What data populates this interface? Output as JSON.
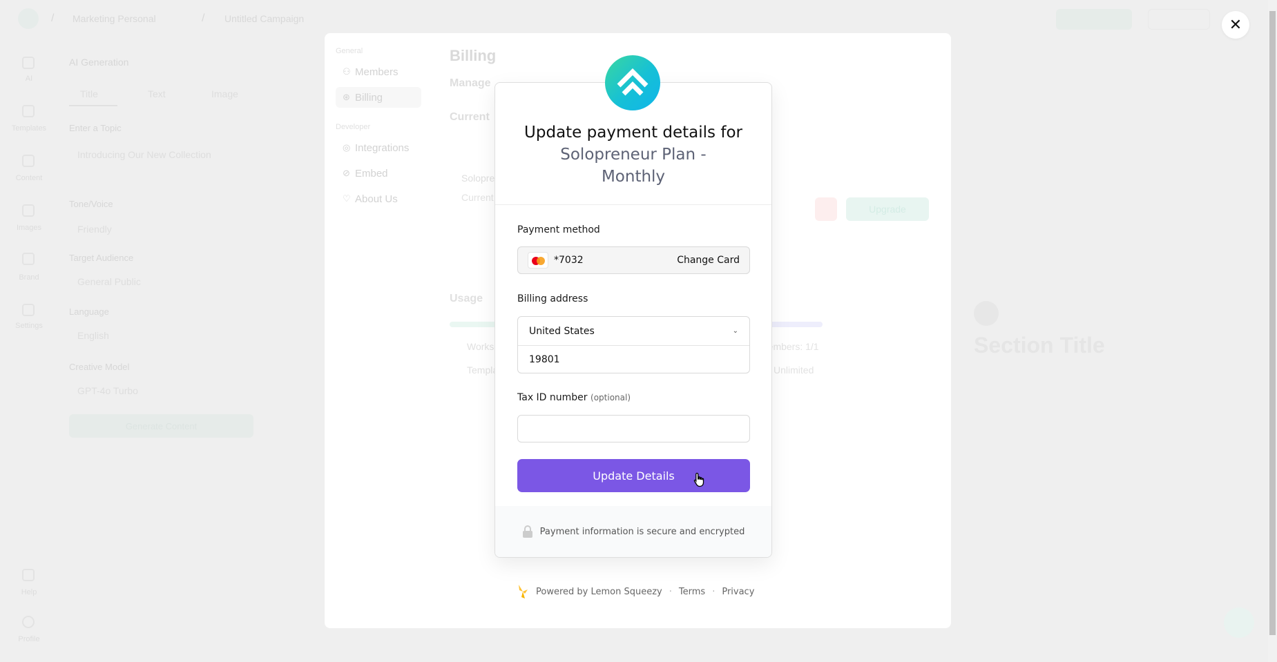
{
  "topbar": {
    "workspace": "Marketing Personal",
    "campaign": "Untitled Campaign"
  },
  "rail": [
    "AI",
    "Templates",
    "Content",
    "Images",
    "Brand",
    "Settings",
    "Help",
    "Profile"
  ],
  "left_panel": {
    "title": "AI Generation",
    "tabs": [
      "Title",
      "Text",
      "Image"
    ],
    "fields": [
      {
        "label": "Enter a Topic",
        "value": "Introducing Our New Collection"
      },
      {
        "label": "Tone/Voice",
        "value": "Friendly"
      },
      {
        "label": "Target Audience",
        "value": "General Public"
      },
      {
        "label": "Language",
        "value": "English"
      },
      {
        "label": "Creative Model",
        "value": "GPT-4o Turbo"
      }
    ],
    "generate_label": "Generate Content"
  },
  "settings": {
    "groups": [
      {
        "label": "General"
      },
      {
        "label": "Developer"
      }
    ],
    "nav": [
      {
        "label": "Members",
        "icon": "users-icon"
      },
      {
        "label": "Billing",
        "icon": "billing-icon",
        "active": true
      },
      {
        "label": "Integrations",
        "icon": "puzzle-icon"
      },
      {
        "label": "Embed",
        "icon": "link-icon"
      },
      {
        "label": "About Us",
        "icon": "heart-icon"
      }
    ],
    "billing_title": "Billing",
    "manage": "Manage",
    "current": "Current",
    "plan_name": "Solopreneur",
    "plan_current": "Current",
    "upgrade": "Upgrade",
    "usage": "Usage",
    "usage_items": [
      "Workspaces",
      "Templates"
    ],
    "members": "Members: 1/1",
    "unlimited": "Unlimited"
  },
  "preview": {
    "section_title": "Section Title"
  },
  "modal": {
    "title_line1": "Update payment details for",
    "plan": "Solopreneur Plan - Monthly",
    "payment_method_label": "Payment method",
    "card_last4": "*7032",
    "change_card": "Change Card",
    "billing_address_label": "Billing address",
    "country": "United States",
    "zip": "19801",
    "tax_label": "Tax ID number",
    "tax_optional": "(optional)",
    "tax_value": "",
    "submit": "Update Details",
    "secure_note": "Payment information is secure and encrypted",
    "accent": "#7b57e5"
  },
  "footer": {
    "powered": "Powered by Lemon Squeezy",
    "terms": "Terms",
    "privacy": "Privacy"
  }
}
